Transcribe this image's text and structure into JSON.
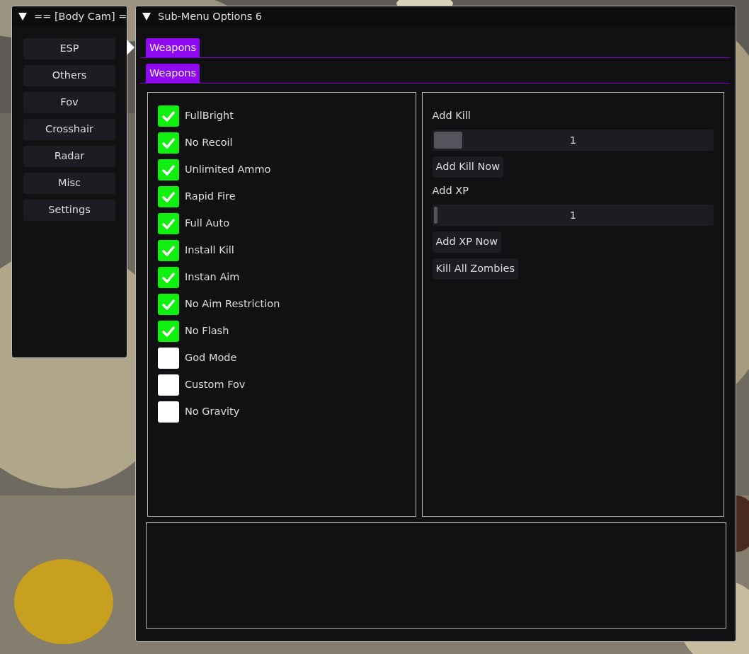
{
  "menu_window": {
    "title": "== [Body Cam] =",
    "expanded": true,
    "items": [
      {
        "label": "ESP",
        "selected": false
      },
      {
        "label": "Others",
        "selected": false
      },
      {
        "label": "Fov",
        "selected": false
      },
      {
        "label": "Crosshair",
        "selected": false
      },
      {
        "label": "Radar",
        "selected": false
      },
      {
        "label": "Misc",
        "selected": false
      },
      {
        "label": "Settings",
        "selected": false
      }
    ]
  },
  "options_window": {
    "title": "Sub-Menu Options 6",
    "expanded": true,
    "tab_bars": [
      {
        "tabs": [
          {
            "label": "Weapons",
            "selected": true
          }
        ]
      },
      {
        "tabs": [
          {
            "label": "Weapons",
            "selected": true
          }
        ]
      }
    ],
    "checkboxes": [
      {
        "label": "FullBright",
        "checked": true
      },
      {
        "label": "No Recoil",
        "checked": true
      },
      {
        "label": "Unlimited Ammo",
        "checked": true
      },
      {
        "label": "Rapid Fire",
        "checked": true
      },
      {
        "label": "Full Auto",
        "checked": true
      },
      {
        "label": "Install Kill",
        "checked": true
      },
      {
        "label": "Instan Aim",
        "checked": true
      },
      {
        "label": "No Aim Restriction",
        "checked": true
      },
      {
        "label": "No Flash",
        "checked": true
      },
      {
        "label": "God Mode",
        "checked": false
      },
      {
        "label": "Custom Fov",
        "checked": false
      },
      {
        "label": "No Gravity",
        "checked": false
      }
    ],
    "controls": [
      {
        "kind": "label",
        "text": "Add Kill"
      },
      {
        "kind": "slider",
        "level": 0,
        "reading": "1"
      },
      {
        "kind": "button",
        "text": "Add Kill Now"
      },
      {
        "kind": "label",
        "text": "Add XP"
      },
      {
        "kind": "slider",
        "level": 0,
        "reading": "1"
      },
      {
        "kind": "button",
        "text": "Add XP Now"
      },
      {
        "kind": "button",
        "text": "Kill All Zombies"
      }
    ]
  }
}
